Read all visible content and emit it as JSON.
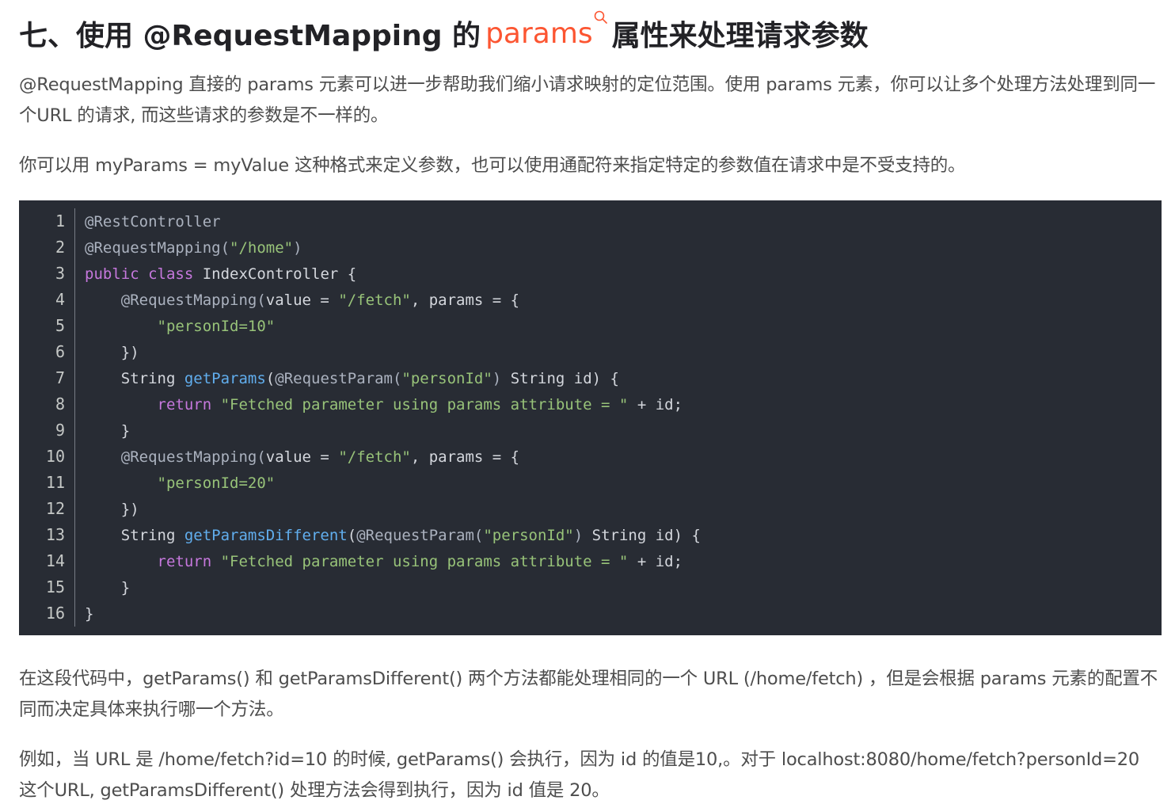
{
  "heading": {
    "prefix": "七、使用 @RequestMapping 的",
    "link_word": "params",
    "suffix": "属性来处理请求参数"
  },
  "paragraphs": {
    "p1": "@RequestMapping 直接的 params 元素可以进一步帮助我们缩小请求映射的定位范围。使用 params 元素，你可以让多个处理方法处理到同一个URL 的请求, 而这些请求的参数是不一样的。",
    "p2": "你可以用 myParams = myValue 这种格式来定义参数，也可以使用通配符来指定特定的参数值在请求中是不受支持的。",
    "p3": "在这段代码中，getParams() 和 getParamsDifferent() 两个方法都能处理相同的一个 URL (/home/fetch) ，但是会根据 params 元素的配置不同而决定具体来执行哪一个方法。",
    "p4": "例如，当 URL 是 /home/fetch?id=10 的时候, getParams() 会执行，因为 id 的值是10,。对于 localhost:8080/home/fetch?personId=20 这个URL, getParamsDifferent() 处理方法会得到执行，因为 id 值是 20。"
  },
  "code": {
    "lines": [
      {
        "n": "1",
        "tokens": [
          [
            "a",
            "@RestController"
          ]
        ]
      },
      {
        "n": "2",
        "tokens": [
          [
            "a",
            "@RequestMapping("
          ],
          [
            "s",
            "\"/home\""
          ],
          [
            "a",
            ")"
          ]
        ]
      },
      {
        "n": "3",
        "tokens": [
          [
            "k",
            "public"
          ],
          [
            "p",
            " "
          ],
          [
            "k",
            "class"
          ],
          [
            "p",
            " IndexController {"
          ]
        ]
      },
      {
        "n": "4",
        "tokens": [
          [
            "p",
            "    "
          ],
          [
            "a",
            "@RequestMapping("
          ],
          [
            "p",
            "value = "
          ],
          [
            "s",
            "\"/fetch\""
          ],
          [
            "p",
            ", params = {"
          ]
        ]
      },
      {
        "n": "5",
        "tokens": [
          [
            "p",
            "        "
          ],
          [
            "s",
            "\"personId=10\""
          ]
        ]
      },
      {
        "n": "6",
        "tokens": [
          [
            "p",
            "    })"
          ]
        ]
      },
      {
        "n": "7",
        "tokens": [
          [
            "p",
            "    String "
          ],
          [
            "f",
            "getParams"
          ],
          [
            "p",
            "("
          ],
          [
            "a",
            "@RequestParam("
          ],
          [
            "s",
            "\"personId\""
          ],
          [
            "a",
            ")"
          ],
          [
            "p",
            " String id) {"
          ]
        ]
      },
      {
        "n": "8",
        "tokens": [
          [
            "p",
            "        "
          ],
          [
            "k",
            "return"
          ],
          [
            "p",
            " "
          ],
          [
            "s",
            "\"Fetched parameter using params attribute = \""
          ],
          [
            "p",
            " + id;"
          ]
        ]
      },
      {
        "n": "9",
        "tokens": [
          [
            "p",
            "    }"
          ]
        ]
      },
      {
        "n": "10",
        "tokens": [
          [
            "p",
            "    "
          ],
          [
            "a",
            "@RequestMapping("
          ],
          [
            "p",
            "value = "
          ],
          [
            "s",
            "\"/fetch\""
          ],
          [
            "p",
            ", params = {"
          ]
        ]
      },
      {
        "n": "11",
        "tokens": [
          [
            "p",
            "        "
          ],
          [
            "s",
            "\"personId=20\""
          ]
        ]
      },
      {
        "n": "12",
        "tokens": [
          [
            "p",
            "    })"
          ]
        ]
      },
      {
        "n": "13",
        "tokens": [
          [
            "p",
            "    String "
          ],
          [
            "f",
            "getParamsDifferent"
          ],
          [
            "p",
            "("
          ],
          [
            "a",
            "@RequestParam("
          ],
          [
            "s",
            "\"personId\""
          ],
          [
            "a",
            ")"
          ],
          [
            "p",
            " String id) {"
          ]
        ]
      },
      {
        "n": "14",
        "tokens": [
          [
            "p",
            "        "
          ],
          [
            "k",
            "return"
          ],
          [
            "p",
            " "
          ],
          [
            "s",
            "\"Fetched parameter using params attribute = \""
          ],
          [
            "p",
            " + id;"
          ]
        ]
      },
      {
        "n": "15",
        "tokens": [
          [
            "p",
            "    }"
          ]
        ]
      },
      {
        "n": "16",
        "tokens": [
          [
            "p",
            "}"
          ]
        ]
      }
    ]
  },
  "colors": {
    "link": "#fc5531",
    "code_background": "#282c34",
    "keyword": "#c678dd",
    "string": "#98c379",
    "function": "#61aeee"
  },
  "icons": [
    "search-icon"
  ]
}
